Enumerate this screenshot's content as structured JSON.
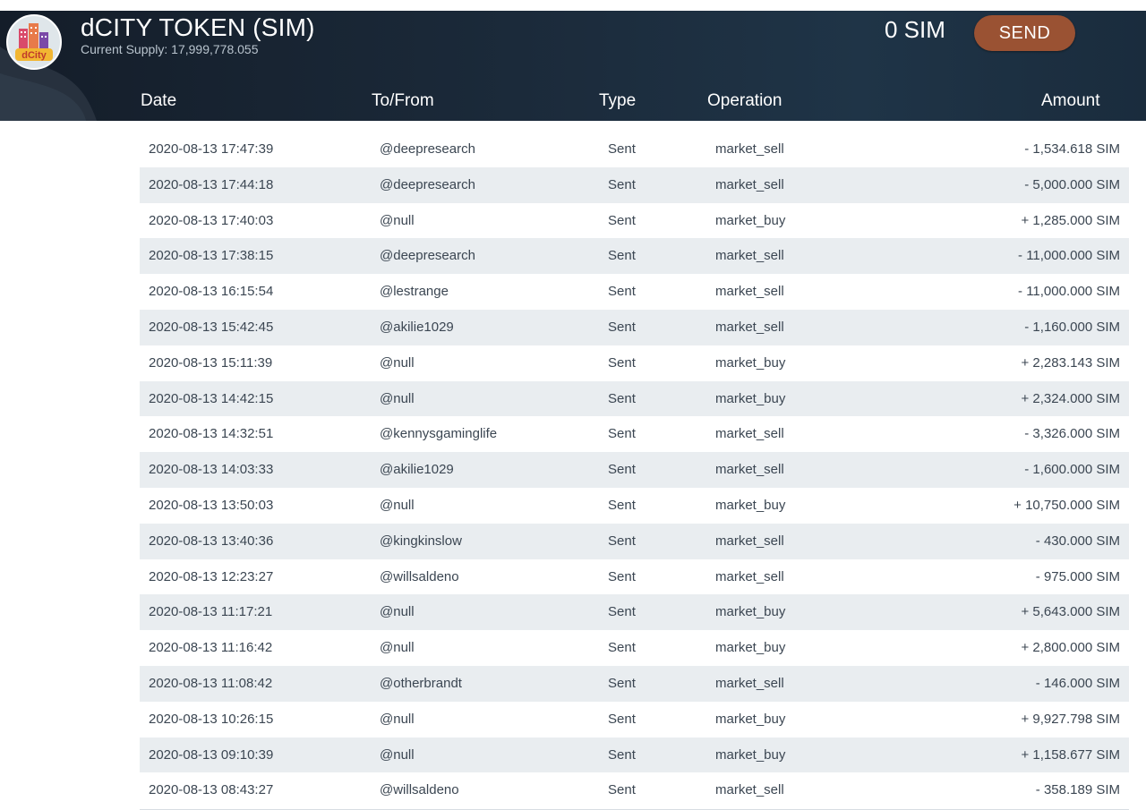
{
  "header": {
    "title": "dCITY TOKEN (SIM)",
    "supply": "Current Supply: 17,999,778.055",
    "balance": "0 SIM",
    "send_label": "SEND",
    "logo_text": "dCity"
  },
  "columns": {
    "date": "Date",
    "to_from": "To/From",
    "type": "Type",
    "operation": "Operation",
    "amount": "Amount"
  },
  "colors": {
    "header_bg": "#1b2a3a",
    "send_button": "#9a5233",
    "row_alt": "#e9edf0",
    "text": "#3b4652"
  },
  "rows": [
    {
      "date": "2020-08-13 17:47:39",
      "to": "@deepresearch",
      "type": "Sent",
      "op": "market_sell",
      "amount": "- 1,534.618 SIM"
    },
    {
      "date": "2020-08-13 17:44:18",
      "to": "@deepresearch",
      "type": "Sent",
      "op": "market_sell",
      "amount": "- 5,000.000 SIM"
    },
    {
      "date": "2020-08-13 17:40:03",
      "to": "@null",
      "type": "Sent",
      "op": "market_buy",
      "amount": "+ 1,285.000 SIM"
    },
    {
      "date": "2020-08-13 17:38:15",
      "to": "@deepresearch",
      "type": "Sent",
      "op": "market_sell",
      "amount": "- 11,000.000 SIM"
    },
    {
      "date": "2020-08-13 16:15:54",
      "to": "@lestrange",
      "type": "Sent",
      "op": "market_sell",
      "amount": "- 11,000.000 SIM"
    },
    {
      "date": "2020-08-13 15:42:45",
      "to": "@akilie1029",
      "type": "Sent",
      "op": "market_sell",
      "amount": "- 1,160.000 SIM"
    },
    {
      "date": "2020-08-13 15:11:39",
      "to": "@null",
      "type": "Sent",
      "op": "market_buy",
      "amount": "+ 2,283.143 SIM"
    },
    {
      "date": "2020-08-13 14:42:15",
      "to": "@null",
      "type": "Sent",
      "op": "market_buy",
      "amount": "+ 2,324.000 SIM"
    },
    {
      "date": "2020-08-13 14:32:51",
      "to": "@kennysgaminglife",
      "type": "Sent",
      "op": "market_sell",
      "amount": "- 3,326.000 SIM"
    },
    {
      "date": "2020-08-13 14:03:33",
      "to": "@akilie1029",
      "type": "Sent",
      "op": "market_sell",
      "amount": "- 1,600.000 SIM"
    },
    {
      "date": "2020-08-13 13:50:03",
      "to": "@null",
      "type": "Sent",
      "op": "market_buy",
      "amount": "+ 10,750.000 SIM"
    },
    {
      "date": "2020-08-13 13:40:36",
      "to": "@kingkinslow",
      "type": "Sent",
      "op": "market_sell",
      "amount": "- 430.000 SIM"
    },
    {
      "date": "2020-08-13 12:23:27",
      "to": "@willsaldeno",
      "type": "Sent",
      "op": "market_sell",
      "amount": "- 975.000 SIM"
    },
    {
      "date": "2020-08-13 11:17:21",
      "to": "@null",
      "type": "Sent",
      "op": "market_buy",
      "amount": "+ 5,643.000 SIM"
    },
    {
      "date": "2020-08-13 11:16:42",
      "to": "@null",
      "type": "Sent",
      "op": "market_buy",
      "amount": "+ 2,800.000 SIM"
    },
    {
      "date": "2020-08-13 11:08:42",
      "to": "@otherbrandt",
      "type": "Sent",
      "op": "market_sell",
      "amount": "- 146.000 SIM"
    },
    {
      "date": "2020-08-13 10:26:15",
      "to": "@null",
      "type": "Sent",
      "op": "market_buy",
      "amount": "+ 9,927.798 SIM"
    },
    {
      "date": "2020-08-13 09:10:39",
      "to": "@null",
      "type": "Sent",
      "op": "market_buy",
      "amount": "+ 1,158.677 SIM"
    },
    {
      "date": "2020-08-13 08:43:27",
      "to": "@willsaldeno",
      "type": "Sent",
      "op": "market_sell",
      "amount": "- 358.189 SIM"
    }
  ]
}
